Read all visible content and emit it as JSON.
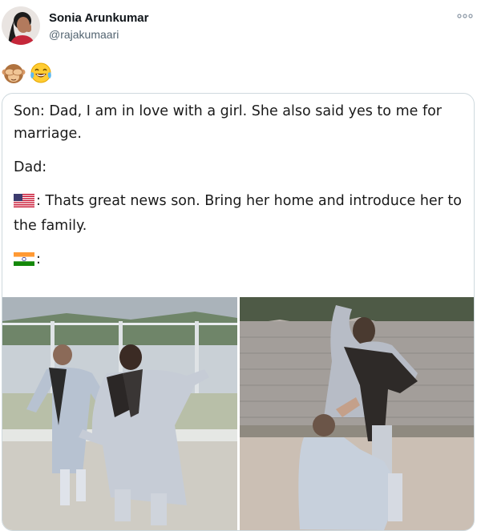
{
  "user": {
    "display_name": "Sonia Arunkumar",
    "handle": "@rajakumaari"
  },
  "tweet": {
    "emojis": [
      "see-no-evil-monkey",
      "tears-of-joy"
    ]
  },
  "meme": {
    "line1": "Son: Dad, I am in love with a girl. She also said yes to me for marriage.",
    "line2": "Dad:",
    "us_text": ": Thats great news son. Bring her home and introduce her to the family.",
    "india_text": ":"
  },
  "colors": {
    "handle_gray": "#536471",
    "border": "#cfd9de"
  }
}
